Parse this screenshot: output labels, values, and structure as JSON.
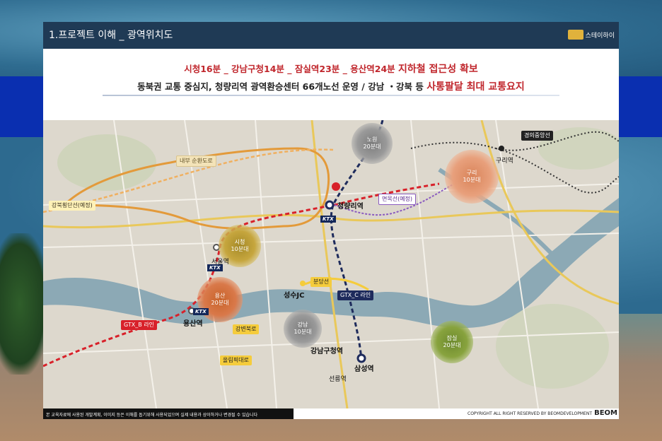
{
  "header": {
    "title": "1.프로젝트 이해 _ 광역위치도",
    "logo_text": "스테이하이"
  },
  "subtitle": {
    "line1_a": "시청16분 _ 강남구청14분 _ 잠실역23분 _ 용산역24분 ",
    "line1_b": "지하철 접근성 확보",
    "line2_a": "동북권 교통 중심지, 청량리역 광역환승센터 66개노선 운영 / 강남 ・강북 등 ",
    "line2_b": "사통팔달 최대 교통요지"
  },
  "map": {
    "labels": {
      "naebu": "내부 순환도로",
      "gangbuk": "강북횡단선(예정)",
      "myeonmok": "면목선(예정)",
      "gyeongui": "경의중앙선",
      "bundang": "분당선",
      "gtxc": "GTX_C 라인",
      "gtxb": "GTX_B 라인",
      "gangbyeon": "강변북로",
      "olympic": "올림픽대로"
    },
    "stations": {
      "cheongnyangni": "청량리역",
      "guri": "구리역",
      "seoul": "서울역",
      "yongsan": "용산역",
      "seongsu": "성수JC",
      "gangnamgu": "강남구청역",
      "samseong": "삼성역",
      "seolleung": "선릉역"
    },
    "circles": {
      "nowon": {
        "name": "노원",
        "time": "20분대"
      },
      "guri": {
        "name": "구리",
        "time": "10분대"
      },
      "sicheong": {
        "name": "시청",
        "time": "10분대"
      },
      "yongsan": {
        "name": "용산",
        "time": "20분대"
      },
      "gangnam": {
        "name": "강남",
        "time": "10분대"
      },
      "jamsil": {
        "name": "잠실",
        "time": "20분대"
      }
    },
    "ktx": "KTX",
    "pin": "현장"
  },
  "footer": {
    "disclaimer": "본 교육자료에 사용된 개발계획, 이미지 등은 이해를 돕기위해 사용되었으며 실제 내용과 상이하거나 변경될 수 있습니다",
    "copyright": "COPYRIGHT ALL RIGHT RESERVED BY BEOMDEVELOPMENT",
    "logo": "BEOM"
  },
  "colors": {
    "header_bg": "#1f3a55",
    "accent_red": "#c0262c",
    "gtx_b": "#d8212a",
    "gtx_c": "#1e2b5c",
    "bundang": "#f5cc3c"
  }
}
